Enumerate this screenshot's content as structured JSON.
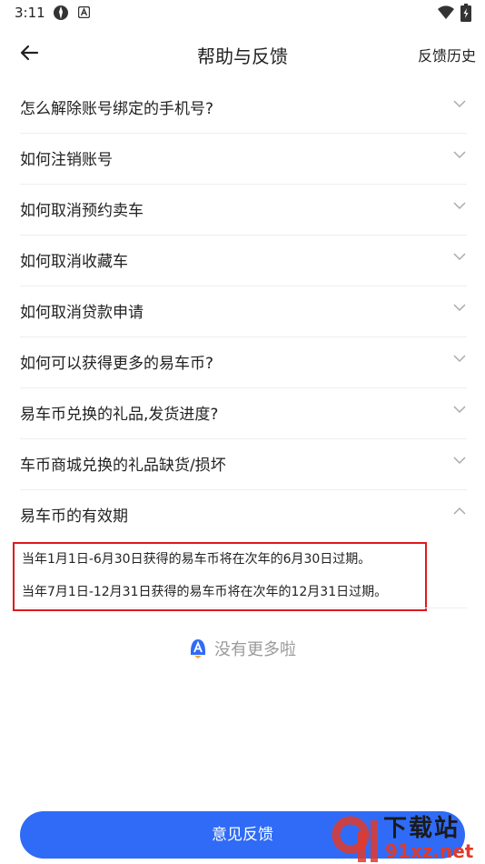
{
  "status_bar": {
    "time": "3:11"
  },
  "header": {
    "title": "帮助与反馈",
    "history_label": "反馈历史"
  },
  "faqs": [
    {
      "question": "怎么解除账号绑定的手机号?",
      "expanded": false
    },
    {
      "question": "如何注销账号",
      "expanded": false
    },
    {
      "question": "如何取消预约卖车",
      "expanded": false
    },
    {
      "question": "如何取消收藏车",
      "expanded": false
    },
    {
      "question": "如何取消贷款申请",
      "expanded": false
    },
    {
      "question": "如何可以获得更多的易车币?",
      "expanded": false
    },
    {
      "question": "易车币兑换的礼品,发货进度?",
      "expanded": false
    },
    {
      "question": "车币商城兑换的礼品缺货/损坏",
      "expanded": false
    },
    {
      "question": "易车币的有效期",
      "expanded": true,
      "answers": [
        "当年1月1日-6月30日获得的易车币将在次年的6月30日过期。",
        "当年7月1日-12月31日获得的易车币将在次年的12月31日过期。"
      ]
    }
  ],
  "no_more_text": "没有更多啦",
  "feedback_button_label": "意见反馈",
  "watermark": {
    "top": "下载站",
    "bottom": "91xz.net"
  },
  "colors": {
    "accent": "#2f6bf6",
    "highlight_border": "#e0191c"
  }
}
